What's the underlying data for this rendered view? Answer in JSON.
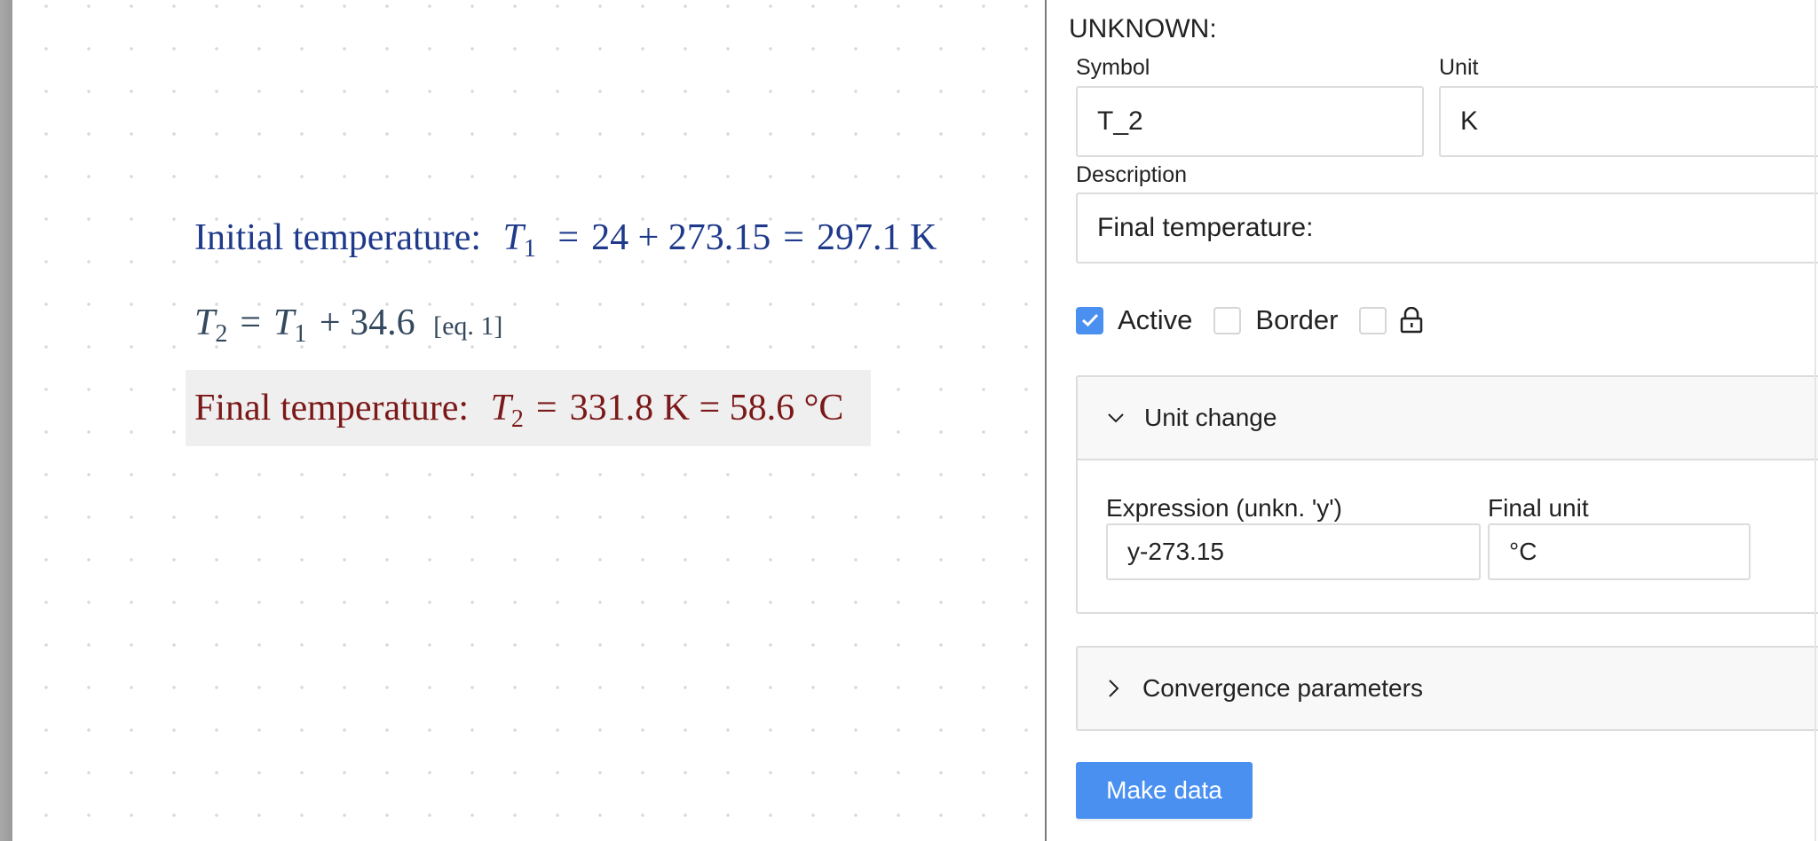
{
  "canvas": {
    "equations": [
      {
        "label": "Initial temperature:",
        "symbol": "T",
        "sub": "1",
        "parts": [
          "=",
          "24 + 273.15",
          "=",
          "297.1 K"
        ],
        "color": "#1f3a8a"
      },
      {
        "symbol": "T",
        "sub": "2",
        "rhs_symbol": "T",
        "rhs_sub": "1",
        "rhs_rest": "+ 34.6",
        "ref": "[eq. 1]",
        "color": "#34495e"
      },
      {
        "label": "Final temperature:",
        "symbol": "T",
        "sub": "2",
        "value": "331.8 K",
        "converted": "= 58.6 °C",
        "color": "#7b1818",
        "highlighted": true
      }
    ]
  },
  "panel": {
    "heading": "UNKNOWN:",
    "symbol_label": "Symbol",
    "symbol_value": "T_2",
    "unit_label": "Unit",
    "unit_value": "K",
    "description_label": "Description",
    "description_value": "Final temperature:",
    "checkboxes": [
      {
        "label": "Active",
        "checked": true
      },
      {
        "label": "Border",
        "checked": false
      },
      {
        "icon": "lock-icon",
        "checked": false
      }
    ],
    "unit_change": {
      "title": "Unit change",
      "expanded": true,
      "expression_label": "Expression (unkn. 'y')",
      "expression_value": "y-273.15",
      "final_unit_label": "Final unit",
      "final_unit_value": "°C"
    },
    "convergence": {
      "title": "Convergence parameters",
      "expanded": false
    },
    "make_data_label": "Make data",
    "accent": "#4a90f0"
  }
}
